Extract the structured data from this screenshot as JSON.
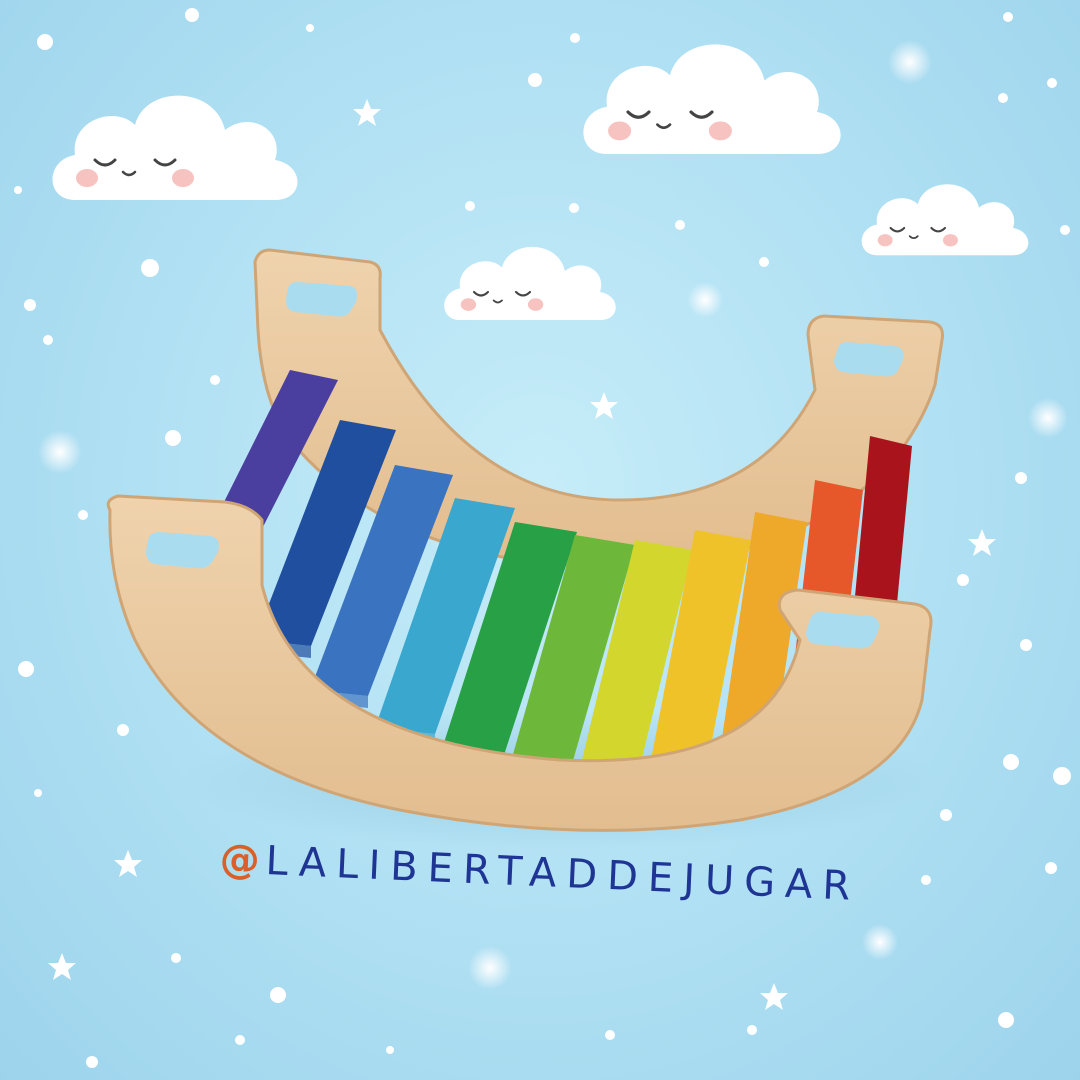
{
  "colors": {
    "sky": "#b3e2f4",
    "wood": "#eac9a0",
    "wood_edge": "#cfa576",
    "at_sign": "#d9602b",
    "handle_text": "#1f3594"
  },
  "clouds": [
    {
      "name": "cloud-top-left",
      "face": "sleeping"
    },
    {
      "name": "cloud-top-right",
      "face": "sleeping"
    },
    {
      "name": "cloud-right-small",
      "face": "sleeping"
    },
    {
      "name": "cloud-center-small",
      "face": "sleeping"
    }
  ],
  "rocker": {
    "slat_colors": [
      "#4a3f9e",
      "#1f4f9e",
      "#3a74c0",
      "#3aa7cf",
      "#27a046",
      "#6db83a",
      "#d3d62c",
      "#f0c22a",
      "#eea82a",
      "#e6582a",
      "#a9141c"
    ]
  },
  "social": {
    "at": "@",
    "handle": "LALIBERTADDEJUGAR"
  }
}
